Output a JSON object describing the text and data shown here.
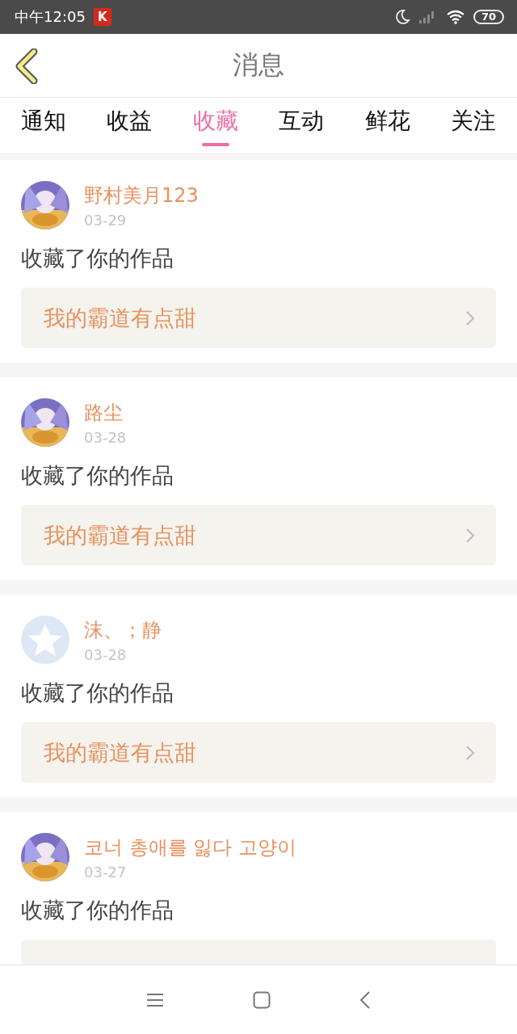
{
  "status_bar": {
    "time": "中午12:05",
    "app_badge": "K",
    "battery": "70"
  },
  "header": {
    "title": "消息"
  },
  "tabs": [
    {
      "label": "通知",
      "selected": false
    },
    {
      "label": "收益",
      "selected": false
    },
    {
      "label": "收藏",
      "selected": true
    },
    {
      "label": "互动",
      "selected": false
    },
    {
      "label": "鲜花",
      "selected": false
    },
    {
      "label": "关注",
      "selected": false
    }
  ],
  "messages": [
    {
      "name": "野村美月123",
      "date": "03-29",
      "text": "收藏了你的作品",
      "work": "我的霸道有点甜"
    },
    {
      "name": "路尘",
      "date": "03-28",
      "text": "收藏了你的作品",
      "work": "我的霸道有点甜"
    },
    {
      "avatar": {
        "kind": "default"
      },
      "name": "沫、；静",
      "date": "03-28",
      "text": "收藏了你的作品",
      "work": "我的霸道有点甜"
    },
    {
      "name": "코너 총애를 잃다 고양이",
      "date": "03-27",
      "text": "收藏了你的作品"
    }
  ]
}
